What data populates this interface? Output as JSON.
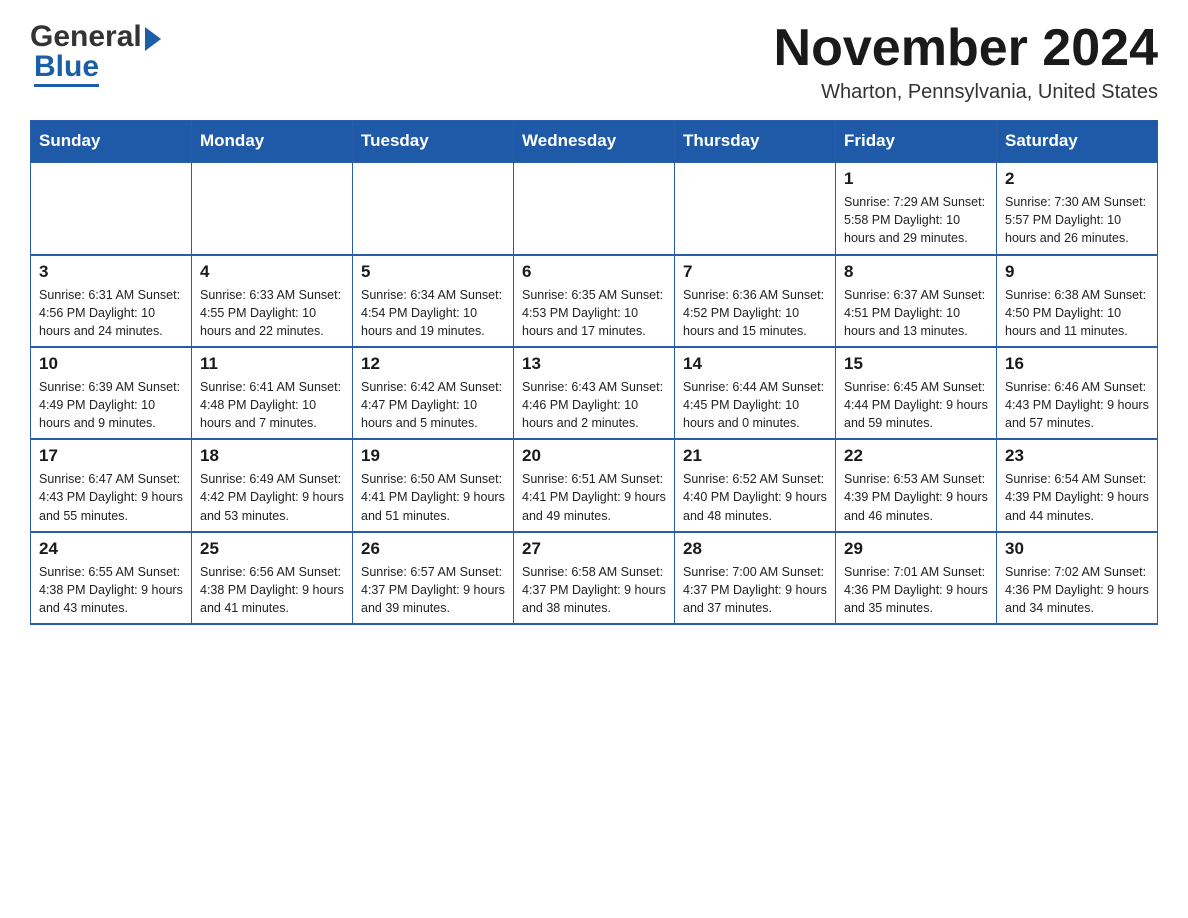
{
  "logo": {
    "general": "General",
    "blue": "Blue"
  },
  "title": "November 2024",
  "subtitle": "Wharton, Pennsylvania, United States",
  "weekdays": [
    "Sunday",
    "Monday",
    "Tuesday",
    "Wednesday",
    "Thursday",
    "Friday",
    "Saturday"
  ],
  "weeks": [
    [
      {
        "day": "",
        "info": ""
      },
      {
        "day": "",
        "info": ""
      },
      {
        "day": "",
        "info": ""
      },
      {
        "day": "",
        "info": ""
      },
      {
        "day": "",
        "info": ""
      },
      {
        "day": "1",
        "info": "Sunrise: 7:29 AM\nSunset: 5:58 PM\nDaylight: 10 hours\nand 29 minutes."
      },
      {
        "day": "2",
        "info": "Sunrise: 7:30 AM\nSunset: 5:57 PM\nDaylight: 10 hours\nand 26 minutes."
      }
    ],
    [
      {
        "day": "3",
        "info": "Sunrise: 6:31 AM\nSunset: 4:56 PM\nDaylight: 10 hours\nand 24 minutes."
      },
      {
        "day": "4",
        "info": "Sunrise: 6:33 AM\nSunset: 4:55 PM\nDaylight: 10 hours\nand 22 minutes."
      },
      {
        "day": "5",
        "info": "Sunrise: 6:34 AM\nSunset: 4:54 PM\nDaylight: 10 hours\nand 19 minutes."
      },
      {
        "day": "6",
        "info": "Sunrise: 6:35 AM\nSunset: 4:53 PM\nDaylight: 10 hours\nand 17 minutes."
      },
      {
        "day": "7",
        "info": "Sunrise: 6:36 AM\nSunset: 4:52 PM\nDaylight: 10 hours\nand 15 minutes."
      },
      {
        "day": "8",
        "info": "Sunrise: 6:37 AM\nSunset: 4:51 PM\nDaylight: 10 hours\nand 13 minutes."
      },
      {
        "day": "9",
        "info": "Sunrise: 6:38 AM\nSunset: 4:50 PM\nDaylight: 10 hours\nand 11 minutes."
      }
    ],
    [
      {
        "day": "10",
        "info": "Sunrise: 6:39 AM\nSunset: 4:49 PM\nDaylight: 10 hours\nand 9 minutes."
      },
      {
        "day": "11",
        "info": "Sunrise: 6:41 AM\nSunset: 4:48 PM\nDaylight: 10 hours\nand 7 minutes."
      },
      {
        "day": "12",
        "info": "Sunrise: 6:42 AM\nSunset: 4:47 PM\nDaylight: 10 hours\nand 5 minutes."
      },
      {
        "day": "13",
        "info": "Sunrise: 6:43 AM\nSunset: 4:46 PM\nDaylight: 10 hours\nand 2 minutes."
      },
      {
        "day": "14",
        "info": "Sunrise: 6:44 AM\nSunset: 4:45 PM\nDaylight: 10 hours\nand 0 minutes."
      },
      {
        "day": "15",
        "info": "Sunrise: 6:45 AM\nSunset: 4:44 PM\nDaylight: 9 hours\nand 59 minutes."
      },
      {
        "day": "16",
        "info": "Sunrise: 6:46 AM\nSunset: 4:43 PM\nDaylight: 9 hours\nand 57 minutes."
      }
    ],
    [
      {
        "day": "17",
        "info": "Sunrise: 6:47 AM\nSunset: 4:43 PM\nDaylight: 9 hours\nand 55 minutes."
      },
      {
        "day": "18",
        "info": "Sunrise: 6:49 AM\nSunset: 4:42 PM\nDaylight: 9 hours\nand 53 minutes."
      },
      {
        "day": "19",
        "info": "Sunrise: 6:50 AM\nSunset: 4:41 PM\nDaylight: 9 hours\nand 51 minutes."
      },
      {
        "day": "20",
        "info": "Sunrise: 6:51 AM\nSunset: 4:41 PM\nDaylight: 9 hours\nand 49 minutes."
      },
      {
        "day": "21",
        "info": "Sunrise: 6:52 AM\nSunset: 4:40 PM\nDaylight: 9 hours\nand 48 minutes."
      },
      {
        "day": "22",
        "info": "Sunrise: 6:53 AM\nSunset: 4:39 PM\nDaylight: 9 hours\nand 46 minutes."
      },
      {
        "day": "23",
        "info": "Sunrise: 6:54 AM\nSunset: 4:39 PM\nDaylight: 9 hours\nand 44 minutes."
      }
    ],
    [
      {
        "day": "24",
        "info": "Sunrise: 6:55 AM\nSunset: 4:38 PM\nDaylight: 9 hours\nand 43 minutes."
      },
      {
        "day": "25",
        "info": "Sunrise: 6:56 AM\nSunset: 4:38 PM\nDaylight: 9 hours\nand 41 minutes."
      },
      {
        "day": "26",
        "info": "Sunrise: 6:57 AM\nSunset: 4:37 PM\nDaylight: 9 hours\nand 39 minutes."
      },
      {
        "day": "27",
        "info": "Sunrise: 6:58 AM\nSunset: 4:37 PM\nDaylight: 9 hours\nand 38 minutes."
      },
      {
        "day": "28",
        "info": "Sunrise: 7:00 AM\nSunset: 4:37 PM\nDaylight: 9 hours\nand 37 minutes."
      },
      {
        "day": "29",
        "info": "Sunrise: 7:01 AM\nSunset: 4:36 PM\nDaylight: 9 hours\nand 35 minutes."
      },
      {
        "day": "30",
        "info": "Sunrise: 7:02 AM\nSunset: 4:36 PM\nDaylight: 9 hours\nand 34 minutes."
      }
    ]
  ],
  "colors": {
    "header_bg": "#1e5aa8",
    "header_text": "#ffffff",
    "border": "#2a5ca8",
    "empty_bg": "#f5f5f5"
  }
}
